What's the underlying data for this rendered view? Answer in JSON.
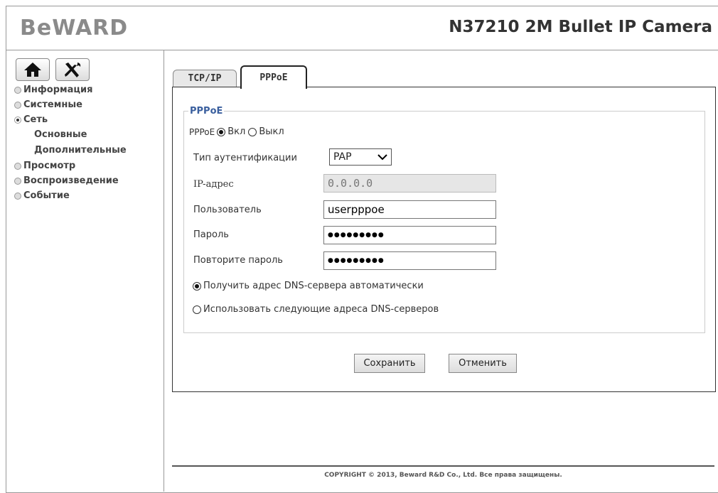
{
  "brand": {
    "logo": "BeWARD",
    "model": "N37210 2M Bullet IP Camera"
  },
  "sidebar": {
    "menu": [
      {
        "label": "Информация"
      },
      {
        "label": "Системные"
      },
      {
        "label": "Сеть"
      },
      {
        "label": "Основные"
      },
      {
        "label": "Дополнительные"
      },
      {
        "label": "Просмотр"
      },
      {
        "label": "Воспроизведение"
      },
      {
        "label": "Событие"
      }
    ]
  },
  "tabs": {
    "tcpip": "TCP/IP",
    "pppoe": "PPPoE"
  },
  "form": {
    "legend": "PPPoE",
    "pppoe_label": "PPPoE",
    "on_label": "Вкл",
    "off_label": "Выкл",
    "auth_label": "Тип аутентификации",
    "auth_value": "PAP",
    "ip_label": "IP-адрес",
    "ip_value": "0.0.0.0",
    "user_label": "Пользователь",
    "user_value": "userpppoe",
    "pass_label": "Пароль",
    "pass_value": "●●●●●●●●●",
    "repass_label": "Повторите пароль",
    "repass_value": "●●●●●●●●●",
    "dns_auto": "Получить адрес DNS-сервера автоматически",
    "dns_manual": "Использовать следующие адреса DNS-серверов"
  },
  "actions": {
    "save": "Сохранить",
    "cancel": "Отменить"
  },
  "footer": {
    "copyright": "COPYRIGHT © 2013, Beward R&D Co., Ltd. Все права защищены."
  }
}
